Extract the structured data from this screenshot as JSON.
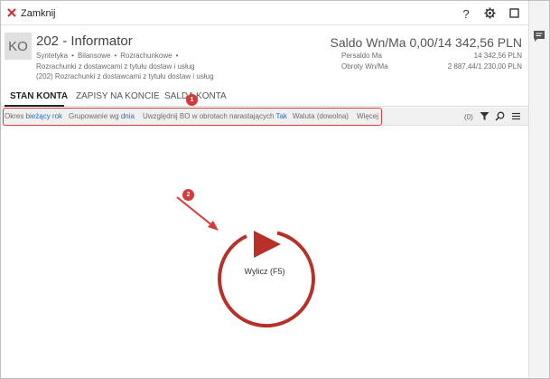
{
  "window": {
    "close_label": "Zamknij"
  },
  "titlebar_icons": [
    "help-icon",
    "gear-icon",
    "maximize-icon",
    "close-icon"
  ],
  "titlebar_glyphs": {
    "help": "?",
    "close": "✕"
  },
  "account": {
    "badge": "KO",
    "title": "202 - Informator",
    "tags": [
      "Syntetyka",
      "Bilansowe",
      "Rozrachunkowe"
    ],
    "tags_separator": "•",
    "desc1": "Rozrachunki z dostawcami z tytułu dostaw i usług",
    "desc2": "(202) Rozrachunki z dostawcami z tytułu dostaw i usług"
  },
  "summary": {
    "saldo": "Saldo Wn/Ma 0,00/14 342,56 PLN",
    "persaldo_label": "Persaldo Ma",
    "persaldo_value": "14 342,56 PLN",
    "obroty_label": "Obroty Wn/Ma",
    "obroty_value": "2 887,44/1 230,00 PLN"
  },
  "tabs": [
    {
      "label": "STAN KONTA",
      "active": true
    },
    {
      "label": "ZAPISY NA KONCIE",
      "active": false
    },
    {
      "label": "SALDA KONTA",
      "active": false
    }
  ],
  "filters": {
    "okres_label": "Okres",
    "okres_value": "bieżący rok",
    "grupowanie_label": "Grupowanie wg",
    "grupowanie_value": "dnia",
    "bo_label": "Uwzględnij BO w obrotach narastających",
    "bo_value": "Tak",
    "waluta": "Waluta (dowolna)",
    "wiecej": "Więcej",
    "count": "(0)"
  },
  "markers": {
    "m1": "1",
    "m2": "2"
  },
  "calc_button": {
    "label": "Wylicz (F5)"
  },
  "colors": {
    "accent_red": "#c0392b",
    "marker_red": "#d33a3a",
    "link_blue": "#2f6fb7"
  }
}
